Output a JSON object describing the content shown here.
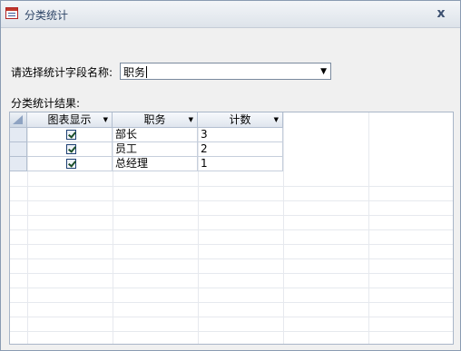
{
  "window": {
    "title": "分类统计",
    "close_label": "x"
  },
  "form": {
    "field_label": "请选择统计字段名称:",
    "field_value": "职务",
    "result_label": "分类统计结果:"
  },
  "grid": {
    "columns": [
      "图表显示",
      "职务",
      "计数"
    ],
    "rows": [
      {
        "show": true,
        "name": "部长",
        "count": "3"
      },
      {
        "show": true,
        "name": "员工",
        "count": "2"
      },
      {
        "show": true,
        "name": "总经理",
        "count": "1"
      }
    ]
  },
  "colors": {
    "title_text": "#2d4466",
    "grid_border": "#a9b6c8",
    "header_bg": "#dfe5ee"
  },
  "icons": {
    "form_icon": "form-icon",
    "close_icon": "close-icon",
    "dropdown_icon": "chevron-down-icon",
    "checkbox": "checkbox-checked"
  }
}
